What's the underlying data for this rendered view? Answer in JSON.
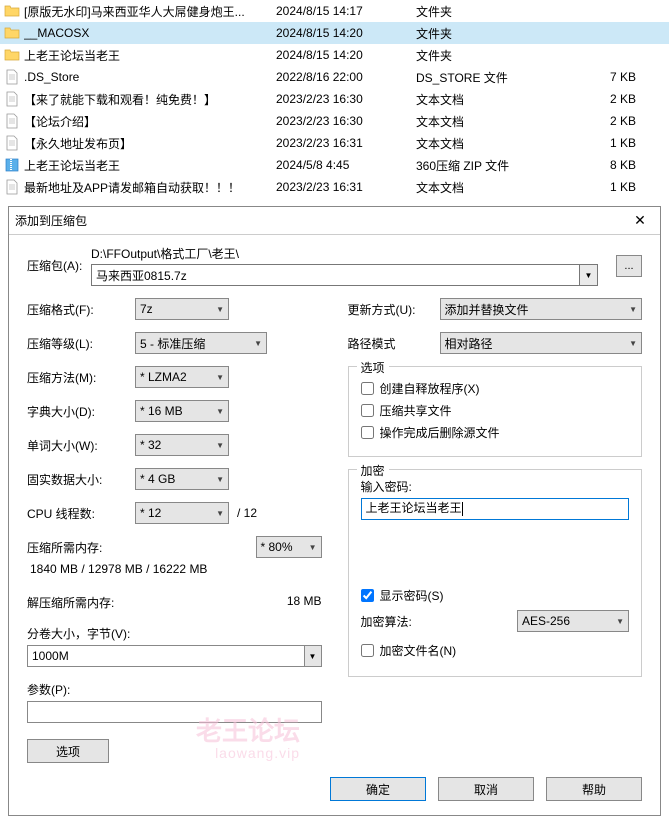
{
  "files": [
    {
      "name": "[原版无水印]马来西亚华人大屌健身炮王...",
      "date": "2024/8/15 14:17",
      "type": "文件夹",
      "size": "",
      "icon": "folder",
      "selected": false
    },
    {
      "name": "__MACOSX",
      "date": "2024/8/15 14:20",
      "type": "文件夹",
      "size": "",
      "icon": "folder",
      "selected": true
    },
    {
      "name": "上老王论坛当老王",
      "date": "2024/8/15 14:20",
      "type": "文件夹",
      "size": "",
      "icon": "folder",
      "selected": false
    },
    {
      "name": ".DS_Store",
      "date": "2022/8/16 22:00",
      "type": "DS_STORE 文件",
      "size": "7 KB",
      "icon": "txt",
      "selected": false
    },
    {
      "name": "【来了就能下载和观看！纯免费！】",
      "date": "2023/2/23 16:30",
      "type": "文本文档",
      "size": "2 KB",
      "icon": "txt",
      "selected": false
    },
    {
      "name": "【论坛介绍】",
      "date": "2023/2/23 16:30",
      "type": "文本文档",
      "size": "2 KB",
      "icon": "txt",
      "selected": false
    },
    {
      "name": "【永久地址发布页】",
      "date": "2023/2/23 16:31",
      "type": "文本文档",
      "size": "1 KB",
      "icon": "txt",
      "selected": false
    },
    {
      "name": "上老王论坛当老王",
      "date": "2024/5/8 4:45",
      "type": "360压缩 ZIP 文件",
      "size": "8 KB",
      "icon": "zip",
      "selected": false
    },
    {
      "name": "最新地址及APP请发邮箱自动获取！！！",
      "date": "2023/2/23 16:31",
      "type": "文本文档",
      "size": "1 KB",
      "icon": "txt",
      "selected": false
    }
  ],
  "dialog": {
    "title": "添加到压缩包",
    "archive_label": "压缩包(A):",
    "archive_path": "D:\\FFOutput\\格式工厂\\老王\\",
    "archive_name": "马来西亚0815.7z",
    "browse": "...",
    "left": {
      "format_label": "压缩格式(F):",
      "format_value": "7z",
      "level_label": "压缩等级(L):",
      "level_value": "5 - 标准压缩",
      "method_label": "压缩方法(M):",
      "method_value": "* LZMA2",
      "dict_label": "字典大小(D):",
      "dict_value": "* 16 MB",
      "word_label": "单词大小(W):",
      "word_value": "* 32",
      "solid_label": "固实数据大小:",
      "solid_value": "* 4 GB",
      "threads_label": "CPU 线程数:",
      "threads_value": "* 12",
      "threads_total": "/ 12",
      "mem_compress_label": "压缩所需内存:",
      "mem_compress_pct": "* 80%",
      "mem_compress_detail": "1840 MB / 12978 MB / 16222 MB",
      "mem_decompress_label": "解压缩所需内存:",
      "mem_decompress_value": "18 MB",
      "split_label": "分卷大小，字节(V):",
      "split_value": "1000M",
      "params_label": "参数(P):",
      "options_btn": "选项"
    },
    "right": {
      "update_label": "更新方式(U):",
      "update_value": "添加并替换文件",
      "pathmode_label": "路径模式",
      "pathmode_value": "相对路径",
      "options_title": "选项",
      "opt_sfx": "创建自释放程序(X)",
      "opt_share": "压缩共享文件",
      "opt_delete": "操作完成后删除源文件",
      "encrypt_title": "加密",
      "pwd_label": "输入密码:",
      "pwd_value": "上老王论坛当老王",
      "show_pwd": "显示密码(S)",
      "enc_alg_label": "加密算法:",
      "enc_alg_value": "AES-256",
      "enc_names": "加密文件名(N)"
    },
    "footer": {
      "ok": "确定",
      "cancel": "取消",
      "help": "帮助"
    }
  },
  "watermark": {
    "main": "老王论坛",
    "sub": "laowang.vip"
  }
}
